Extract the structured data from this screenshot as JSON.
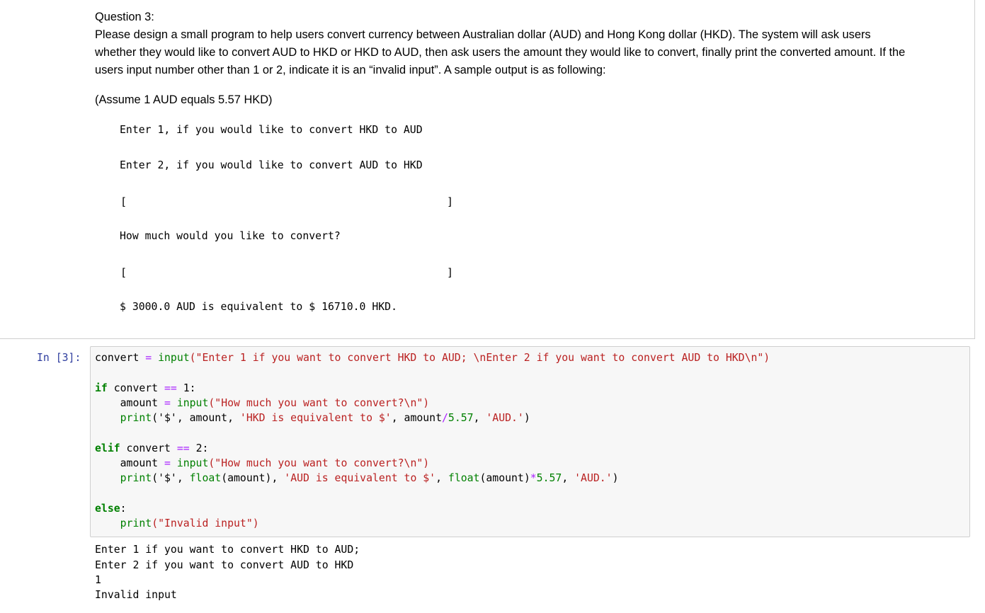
{
  "markdown": {
    "title": "Question 3:",
    "paragraph_lines": [
      "Please design a small program to help users convert currency between Australian dollar (AUD) and Hong Kong dollar (HKD). The system will ask users",
      "whether they would like to convert AUD to HKD or HKD to AUD, then ask users the amount they would like to convert, finally print the converted amount. If the",
      "users input number other than 1 or 2, indicate it is an “invalid input”. A sample output is as following:"
    ],
    "assumption": "(Assume 1 AUD equals 5.57 HKD)",
    "sample": {
      "line1": "Enter 1, if you would like to convert HKD to AUD",
      "line2": "Enter 2, if you would like to convert AUD to HKD",
      "bracket_open": "[",
      "bracket_close": "]",
      "line3": "How much would you like to convert?",
      "line4": "$ 3000.0 AUD is equivalent to $ 16710.0 HKD."
    }
  },
  "cell": {
    "prompt": "In [3]:",
    "code": {
      "l1_var": "convert",
      "l1_eq": " = ",
      "l1_fn": "input",
      "l1_str": "(\"Enter 1 if you want to convert HKD to AUD; \\nEnter 2 if you want to convert AUD to HKD\\n\")",
      "if_kw": "if",
      "if_rest": " convert ",
      "if_op": "==",
      "if_val": " 1:",
      "a_var": "    amount",
      "a_eq": " = ",
      "a_fn": "input",
      "a_str": "(\"How much you want to convert?\\n\")",
      "p1_fn": "    print",
      "p1_a": "('$', amount, ",
      "p1_str": "'HKD is equivalent to $'",
      "p1_b": ", amount",
      "p1_op": "/",
      "p1_num": "5.57",
      "p1_c": ", ",
      "p1_str2": "'AUD.'",
      "p1_d": ")",
      "elif_kw": "elif",
      "elif_rest": " convert ",
      "elif_op": "==",
      "elif_val": " 2:",
      "p2_fn": "    print",
      "p2_a": "('$', ",
      "p2_float": "float",
      "p2_b": "(amount), ",
      "p2_str": "'AUD is equivalent to $'",
      "p2_c": ", ",
      "p2_float2": "float",
      "p2_d": "(amount)",
      "p2_op": "*",
      "p2_num": "5.57",
      "p2_e": ", ",
      "p2_str2": "'AUD.'",
      "p2_f": ")",
      "else_kw": "else",
      "else_colon": ":",
      "p3_fn": "    print",
      "p3_str": "(\"Invalid input\")"
    },
    "output_lines": [
      "Enter 1 if you want to convert HKD to AUD;",
      "Enter 2 if you want to convert AUD to HKD",
      "1",
      "Invalid input"
    ]
  }
}
